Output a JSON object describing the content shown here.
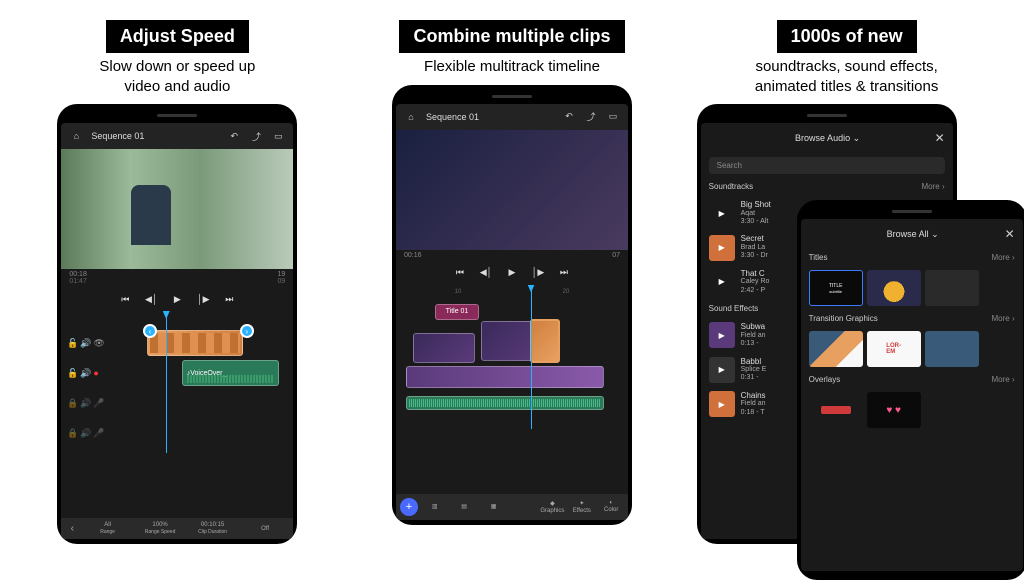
{
  "columns": [
    {
      "title": "Adjust Speed",
      "subtitle": "Slow down or speed up\nvideo and audio"
    },
    {
      "title": "Combine multiple clips",
      "subtitle": "Flexible multitrack timeline"
    },
    {
      "title": "1000s of new",
      "subtitle": "soundtracks, sound effects,\nanimated titles & transitions"
    }
  ],
  "phone1": {
    "sequence": "Sequence 01",
    "time_current": "00:18",
    "time_frames": "19",
    "time_total": "01:47",
    "time_total_frames": "09",
    "voiceover": "VoiceOver_",
    "bottom": {
      "all": "All",
      "range": "Range",
      "speed": "100%",
      "speed_lbl": "Range Speed",
      "duration": "00:10:15",
      "duration_lbl": "Clip Duration",
      "off": "Off"
    }
  },
  "phone2": {
    "sequence": "Sequence 01",
    "time_current": "00:16",
    "time_frames": "07",
    "title_clip": "Title 01",
    "ruler": [
      "10",
      "20"
    ],
    "bottom": [
      "Graphics",
      "Effects",
      "Color"
    ]
  },
  "phone3": {
    "header": "Browse Audio",
    "header_caret": "⌄",
    "search": "Search",
    "sec_soundtracks": "Soundtracks",
    "more": "More",
    "sec_effects": "Sound Effects",
    "tracks": [
      {
        "name": "Big Shot",
        "artist": "Aqat",
        "dur": "3:30 - Alt"
      },
      {
        "name": "Secret",
        "artist": "Brad La",
        "dur": "3:30 - Dr"
      },
      {
        "name": "That C",
        "artist": "Caley Ro",
        "dur": "2:42 - P"
      }
    ],
    "effects": [
      {
        "name": "Subwa",
        "artist": "Field an",
        "dur": "0:13 -"
      },
      {
        "name": "Babbl",
        "artist": "Splice E",
        "dur": "0:31 -"
      },
      {
        "name": "Chains",
        "artist": "Field an",
        "dur": "0:18 - T"
      }
    ]
  },
  "phone4": {
    "header": "Browse All",
    "header_caret": "⌄",
    "sec_titles": "Titles",
    "sec_trans": "Transition Graphics",
    "sec_overlays": "Overlays",
    "more": "More",
    "tile_title": "TITLE",
    "tile_title_sub": "subtitle",
    "tile_lorem": "LOR-\nEM"
  }
}
